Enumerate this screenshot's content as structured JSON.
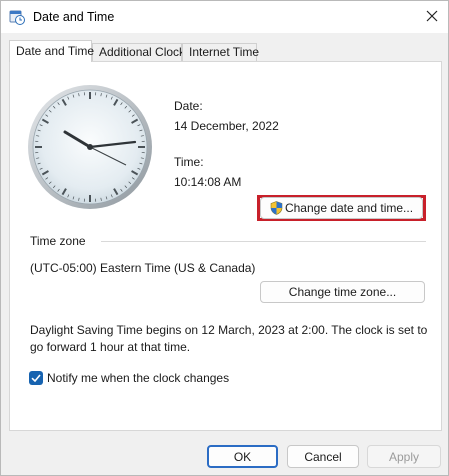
{
  "window": {
    "title": "Date and Time"
  },
  "tabs": [
    {
      "label": "Date and Time"
    },
    {
      "label": "Additional Clocks"
    },
    {
      "label": "Internet Time"
    }
  ],
  "datetime": {
    "date_label": "Date:",
    "date_value": "14 December, 2022",
    "time_label": "Time:",
    "time_value": "10:14:08 AM",
    "change_button": "Change date and time..."
  },
  "timezone": {
    "section_label": "Time zone",
    "value": "(UTC-05:00) Eastern Time (US & Canada)",
    "change_button": "Change time zone..."
  },
  "dst": {
    "line1": "Daylight Saving Time begins on 12 March, 2023 at 2:00. The clock is set to",
    "line2": "go forward 1 hour at that time."
  },
  "notify": {
    "label": "Notify me when the clock changes",
    "checked": true
  },
  "footer": {
    "ok": "OK",
    "cancel": "Cancel",
    "apply": "Apply"
  },
  "colors": {
    "highlight": "#c8202a",
    "accent": "#1763b0"
  },
  "icons": [
    "date-time-app-icon",
    "close-icon",
    "analog-clock",
    "uac-shield-icon",
    "checkmark-icon"
  ]
}
